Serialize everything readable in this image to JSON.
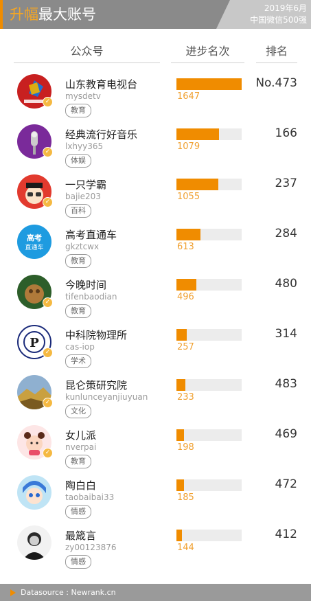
{
  "header": {
    "title_highlight": "升幅",
    "title_rest": "最大账号",
    "badge_line1": "2019年6月",
    "badge_line2": "中国微信500强",
    "accent_color": "#f08c00"
  },
  "columns": {
    "account": "公众号",
    "progress": "进步名次",
    "rank": "排名"
  },
  "rows": [
    {
      "name": "山东教育电视台",
      "handle": "mysdetv",
      "tag": "教育",
      "progress": 1647,
      "rank": "No.473",
      "verified": true
    },
    {
      "name": "经典流行好音乐",
      "handle": "lxhyy365",
      "tag": "体娱",
      "progress": 1079,
      "rank": "166",
      "verified": true
    },
    {
      "name": "一只学霸",
      "handle": "bajie203",
      "tag": "百科",
      "progress": 1055,
      "rank": "237",
      "verified": true
    },
    {
      "name": "高考直通车",
      "handle": "gkztcwx",
      "tag": "教育",
      "progress": 613,
      "rank": "284",
      "verified": false
    },
    {
      "name": "今晚时间",
      "handle": "tifenbaodian",
      "tag": "教育",
      "progress": 496,
      "rank": "480",
      "verified": true
    },
    {
      "name": "中科院物理所",
      "handle": "cas-iop",
      "tag": "学术",
      "progress": 257,
      "rank": "314",
      "verified": true
    },
    {
      "name": "昆仑策研究院",
      "handle": "kunlunceyanjiuyuan",
      "tag": "文化",
      "progress": 233,
      "rank": "483",
      "verified": true
    },
    {
      "name": "女儿派",
      "handle": "nverpai",
      "tag": "教育",
      "progress": 198,
      "rank": "469",
      "verified": true
    },
    {
      "name": "陶白白",
      "handle": "taobaibai33",
      "tag": "情感",
      "progress": 185,
      "rank": "472",
      "verified": false
    },
    {
      "name": "最箴言",
      "handle": "zy00123876",
      "tag": "情感",
      "progress": 144,
      "rank": "412",
      "verified": false
    }
  ],
  "progress_max": 1647,
  "footer": {
    "source": "Datasource : Newrank.cn"
  }
}
